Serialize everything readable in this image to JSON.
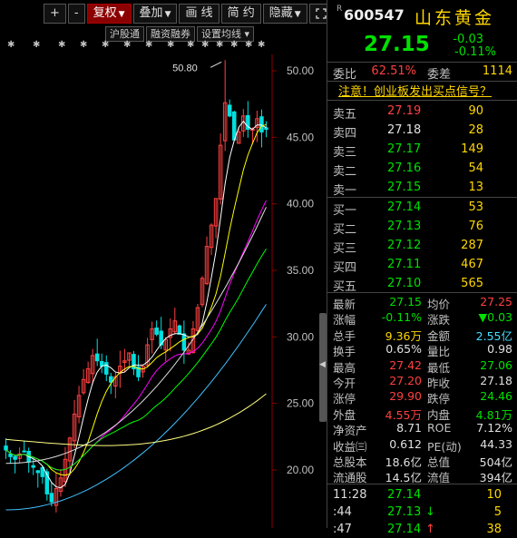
{
  "toolbar": {
    "plus_label": "+",
    "minus_label": "-",
    "fuquan_label": "复权",
    "diejia_label": "叠加",
    "draw_label": "画 线",
    "simple_label": "简 约",
    "hide_label": "隐藏",
    "dropdown_arrow": "▼",
    "fullscreen_icon": "expand-icon"
  },
  "sub_toolbar": {
    "hugutong_label": "沪股通",
    "rongzi_label": "融资融券",
    "ma_settings_label": "设置均线",
    "ma_dropdown_arrow": "▾"
  },
  "chart": {
    "high_annotation": "50.80",
    "marker_glyph": "✱",
    "colors": {
      "up": "#ff4040",
      "down": "#00e0e0",
      "ma5": "#ffffff",
      "ma10": "#ffff00",
      "ma20": "#ff00ff",
      "ma30": "#00ff00",
      "ma60": "#dddddd",
      "ma120": "#40c0ff",
      "ma250": "#ffff80"
    }
  },
  "chart_data": {
    "type": "candlestick",
    "y_axis_labels": [
      "50.00",
      "45.00",
      "40.00",
      "35.00",
      "30.00",
      "25.00",
      "20.00"
    ],
    "ylim": [
      16.0,
      51.5
    ],
    "highest_price_label": "50.80",
    "approx_closes": [
      21.5,
      21.0,
      20.8,
      21.2,
      21.4,
      20.6,
      20.2,
      19.8,
      19.5,
      18.2,
      17.6,
      18.6,
      19.4,
      20.8,
      22.4,
      24.2,
      25.6,
      26.8,
      27.6,
      28.6,
      28.2,
      27.8,
      27.2,
      26.6,
      27.0,
      27.8,
      28.2,
      28.8,
      27.6,
      27.0,
      27.8,
      29.4,
      30.6,
      30.2,
      29.4,
      29.8,
      30.6,
      31.2,
      30.2,
      29.0,
      29.0,
      30.6,
      32.2,
      34.4,
      36.8,
      38.4,
      40.4,
      44.4,
      47.6,
      46.6,
      44.8,
      45.4,
      46.6,
      45.6,
      45.6,
      46.4,
      45.4,
      45.6
    ]
  },
  "quote": {
    "r_badge": "R",
    "code": "600547",
    "name": "山东黄金",
    "last_price": "27.15",
    "change_abs": "-0.03",
    "change_pct": "-0.11%",
    "weibi_label": "委比",
    "weibi_value": "62.51%",
    "weicha_label": "委差",
    "weicha_value": "1114",
    "notice": "注意！创业板发出买点信号？",
    "asks": [
      {
        "label": "卖五",
        "price": "27.19",
        "vol": "90"
      },
      {
        "label": "卖四",
        "price": "27.18",
        "vol": "28"
      },
      {
        "label": "卖三",
        "price": "27.17",
        "vol": "149"
      },
      {
        "label": "卖二",
        "price": "27.16",
        "vol": "54"
      },
      {
        "label": "卖一",
        "price": "27.15",
        "vol": "13"
      }
    ],
    "bids": [
      {
        "label": "买一",
        "price": "27.14",
        "vol": "53"
      },
      {
        "label": "买二",
        "price": "27.13",
        "vol": "76"
      },
      {
        "label": "买三",
        "price": "27.12",
        "vol": "287"
      },
      {
        "label": "买四",
        "price": "27.11",
        "vol": "467"
      },
      {
        "label": "买五",
        "price": "27.10",
        "vol": "565"
      }
    ],
    "stats": [
      {
        "l1": "最新",
        "v1": "27.15",
        "c1": "green",
        "l2": "均价",
        "v2": "27.25",
        "c2": "red"
      },
      {
        "l1": "涨幅",
        "v1": "-0.11%",
        "c1": "green",
        "l2": "涨跌",
        "v2": "▼0.03",
        "c2": "green"
      },
      {
        "l1": "总手",
        "v1": "9.36万",
        "c1": "yellow",
        "l2": "金额",
        "v2": "2.55亿",
        "c2": "cyan"
      },
      {
        "l1": "换手",
        "v1": "0.65%",
        "c1": "white",
        "l2": "量比",
        "v2": "0.98",
        "c2": "white"
      },
      {
        "l1": "最高",
        "v1": "27.42",
        "c1": "red",
        "l2": "最低",
        "v2": "27.06",
        "c2": "green"
      },
      {
        "l1": "今开",
        "v1": "27.20",
        "c1": "red",
        "l2": "昨收",
        "v2": "27.18",
        "c2": "white"
      },
      {
        "l1": "涨停",
        "v1": "29.90",
        "c1": "red",
        "l2": "跌停",
        "v2": "24.46",
        "c2": "green"
      },
      {
        "l1": "外盘",
        "v1": "4.55万",
        "c1": "red",
        "l2": "内盘",
        "v2": "4.81万",
        "c2": "green"
      },
      {
        "l1": "净资产",
        "v1": "8.71",
        "c1": "white",
        "l2": "ROE",
        "v2": "7.12%",
        "c2": "white"
      },
      {
        "l1": "收益㈢",
        "v1": "0.612",
        "c1": "white",
        "l2": "PE(动)",
        "v2": "44.33",
        "c2": "white"
      },
      {
        "l1": "总股本",
        "v1": "18.6亿",
        "c1": "white",
        "l2": "总值",
        "v2": "504亿",
        "c2": "white"
      },
      {
        "l1": "流通股",
        "v1": "14.5亿",
        "c1": "white",
        "l2": "流值",
        "v2": "394亿",
        "c2": "white"
      }
    ],
    "ticks": [
      {
        "time": "11:28",
        "price": "27.14",
        "arrow": "",
        "vol": "10"
      },
      {
        "time": ":44",
        "price": "27.13",
        "arrow": "↓",
        "vol": "5"
      },
      {
        "time": ":47",
        "price": "27.14",
        "arrow": "↑",
        "vol": "38"
      }
    ]
  }
}
